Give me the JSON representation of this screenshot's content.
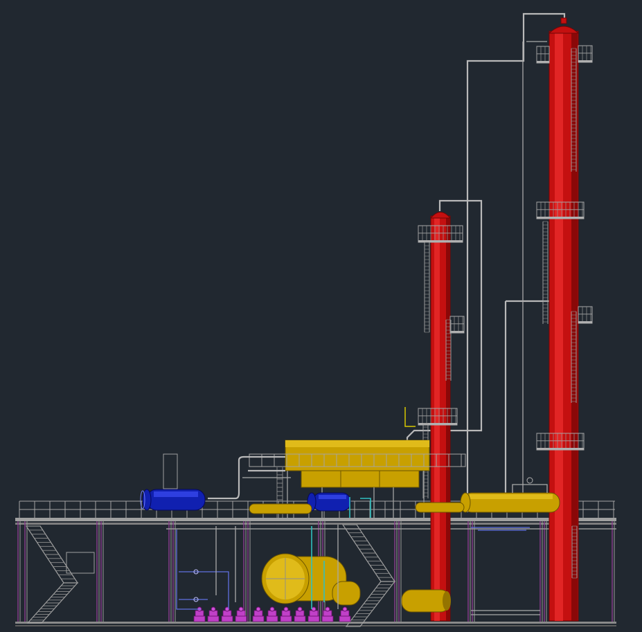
{
  "scene": {
    "background_color": "#212830",
    "colors": {
      "columns": "#c41010",
      "steel_structure": "#9a9a9a",
      "vessels": "#c8a000",
      "exchangers": "#1020b0",
      "pump_bases": "#c040c8",
      "piping": "#b9b9b9",
      "utility_piping": "#30c0c0"
    }
  },
  "equipment": {
    "tall_column": "distillation-column-tall",
    "short_column": "distillation-column-short",
    "air_cooler": "air-cooler-bank",
    "blue_exchanger_left": "heat-exchanger",
    "blue_exchanger_mid": "heat-exchanger",
    "reflux_drum_right": "horizontal-drum",
    "storage_tank": "horizontal-tank",
    "pumps": "pump-row",
    "pipe_rack": "pipe-rack-structure",
    "stairs": "staircase"
  }
}
